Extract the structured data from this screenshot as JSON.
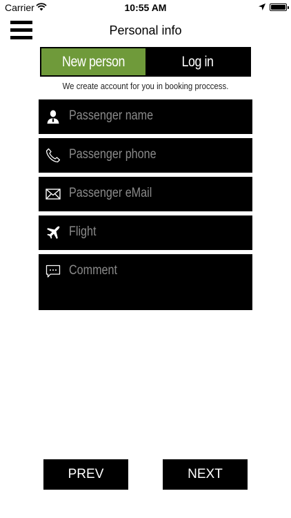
{
  "status_bar": {
    "carrier": "Carrier",
    "time": "10:55 AM",
    "icons": [
      "wifi-icon",
      "location-arrow-icon",
      "battery-icon"
    ]
  },
  "header": {
    "title": "Personal info",
    "menu_icon": "hamburger-menu-icon"
  },
  "tabs": [
    {
      "label": "New person",
      "active": true
    },
    {
      "label": "Log in",
      "active": false
    }
  ],
  "hint": "We create account for you in booking proccess.",
  "form": {
    "fields": [
      {
        "icon": "person-icon",
        "placeholder": "Passenger name",
        "value": ""
      },
      {
        "icon": "phone-icon",
        "placeholder": "Passenger phone",
        "value": ""
      },
      {
        "icon": "envelope-icon",
        "placeholder": "Passenger eMail",
        "value": ""
      },
      {
        "icon": "airplane-icon",
        "placeholder": "Flight",
        "value": ""
      },
      {
        "icon": "comment-icon",
        "placeholder": "Comment",
        "value": ""
      }
    ]
  },
  "footer": {
    "prev_label": "PREV",
    "next_label": "NEXT"
  },
  "colors": {
    "accent": "#6f9a3a",
    "field_bg": "#000000",
    "placeholder": "#8a8a8a"
  }
}
